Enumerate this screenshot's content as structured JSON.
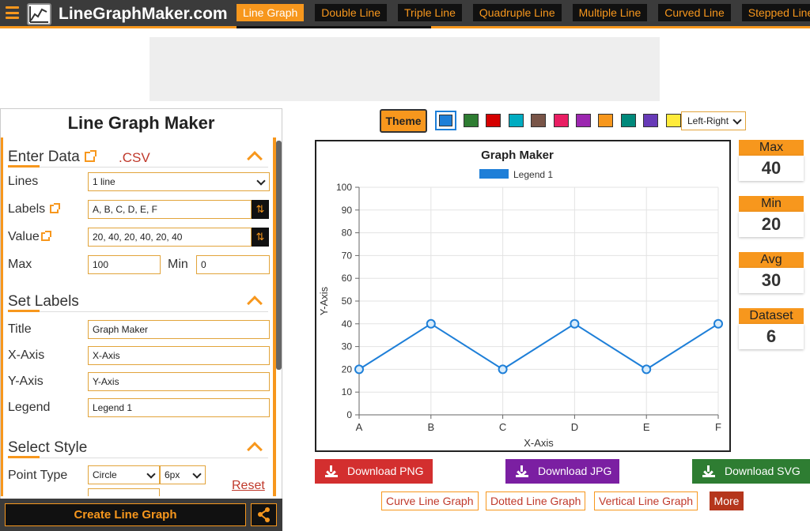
{
  "nav": {
    "logo_text": "LineGraphMaker.com",
    "tabs": [
      {
        "label": "Line Graph",
        "active": true
      },
      {
        "label": "Double Line",
        "active": false
      },
      {
        "label": "Triple Line",
        "active": false
      },
      {
        "label": "Quadruple Line",
        "active": false
      },
      {
        "label": "Multiple Line",
        "active": false
      },
      {
        "label": "Curved Line",
        "active": false
      },
      {
        "label": "Stepped Line",
        "active": false
      }
    ]
  },
  "panel": {
    "title": "Line Graph Maker",
    "enter_data": {
      "heading": "Enter Data",
      "csv_label": ".CSV",
      "lines_label": "Lines",
      "lines_value": "1 line",
      "labels_label": "Labels",
      "labels_value": "A, B, C, D, E, F",
      "value_label": "Value",
      "value_value": "20, 40, 20, 40, 20, 40",
      "max_label": "Max",
      "max_value": "100",
      "min_label": "Min",
      "min_value": "0"
    },
    "set_labels": {
      "heading": "Set Labels",
      "title_label": "Title",
      "title_value": "Graph Maker",
      "xaxis_label": "X-Axis",
      "xaxis_value": "X-Axis",
      "yaxis_label": "Y-Axis",
      "yaxis_value": "Y-Axis",
      "legend_label": "Legend",
      "legend_value": "Legend 1"
    },
    "select_style": {
      "heading": "Select Style",
      "point_type_label": "Point Type",
      "point_type_value": "Circle",
      "point_size_value": "6px",
      "reset_label": "Reset"
    },
    "create_button": "Create Line Graph"
  },
  "theme": {
    "button_label": "Theme",
    "swatches": [
      "#1e7fd8",
      "#2e7d32",
      "#d50000",
      "#00acc1",
      "#795548",
      "#e91e63",
      "#9c27b0",
      "#f7971d",
      "#00897b",
      "#673ab7",
      "#ffeb3b"
    ],
    "selected_index": 0,
    "direction_value": "Left-Right"
  },
  "chart_data": {
    "type": "line",
    "title": "Graph Maker",
    "xlabel": "X-Axis",
    "ylabel": "Y-Axis",
    "categories": [
      "A",
      "B",
      "C",
      "D",
      "E",
      "F"
    ],
    "series": [
      {
        "name": "Legend 1",
        "values": [
          20,
          40,
          20,
          40,
          20,
          40
        ],
        "color": "#1e7fd8"
      }
    ],
    "ylim": [
      0,
      100
    ],
    "yticks": [
      0,
      10,
      20,
      30,
      40,
      50,
      60,
      70,
      80,
      90,
      100
    ],
    "grid": true,
    "legend_position": "top"
  },
  "stats": [
    {
      "label": "Max",
      "value": "40"
    },
    {
      "label": "Min",
      "value": "20"
    },
    {
      "label": "Avg",
      "value": "30"
    },
    {
      "label": "Dataset",
      "value": "6"
    }
  ],
  "downloads": [
    {
      "label": "Download PNG",
      "color": "#d32f2f"
    },
    {
      "label": "Download JPG",
      "color": "#7b1fa2"
    },
    {
      "label": "Download SVG",
      "color": "#2e7d32"
    }
  ],
  "related": [
    "Curve Line Graph",
    "Dotted Line Graph",
    "Vertical Line Graph"
  ],
  "more_label": "More"
}
